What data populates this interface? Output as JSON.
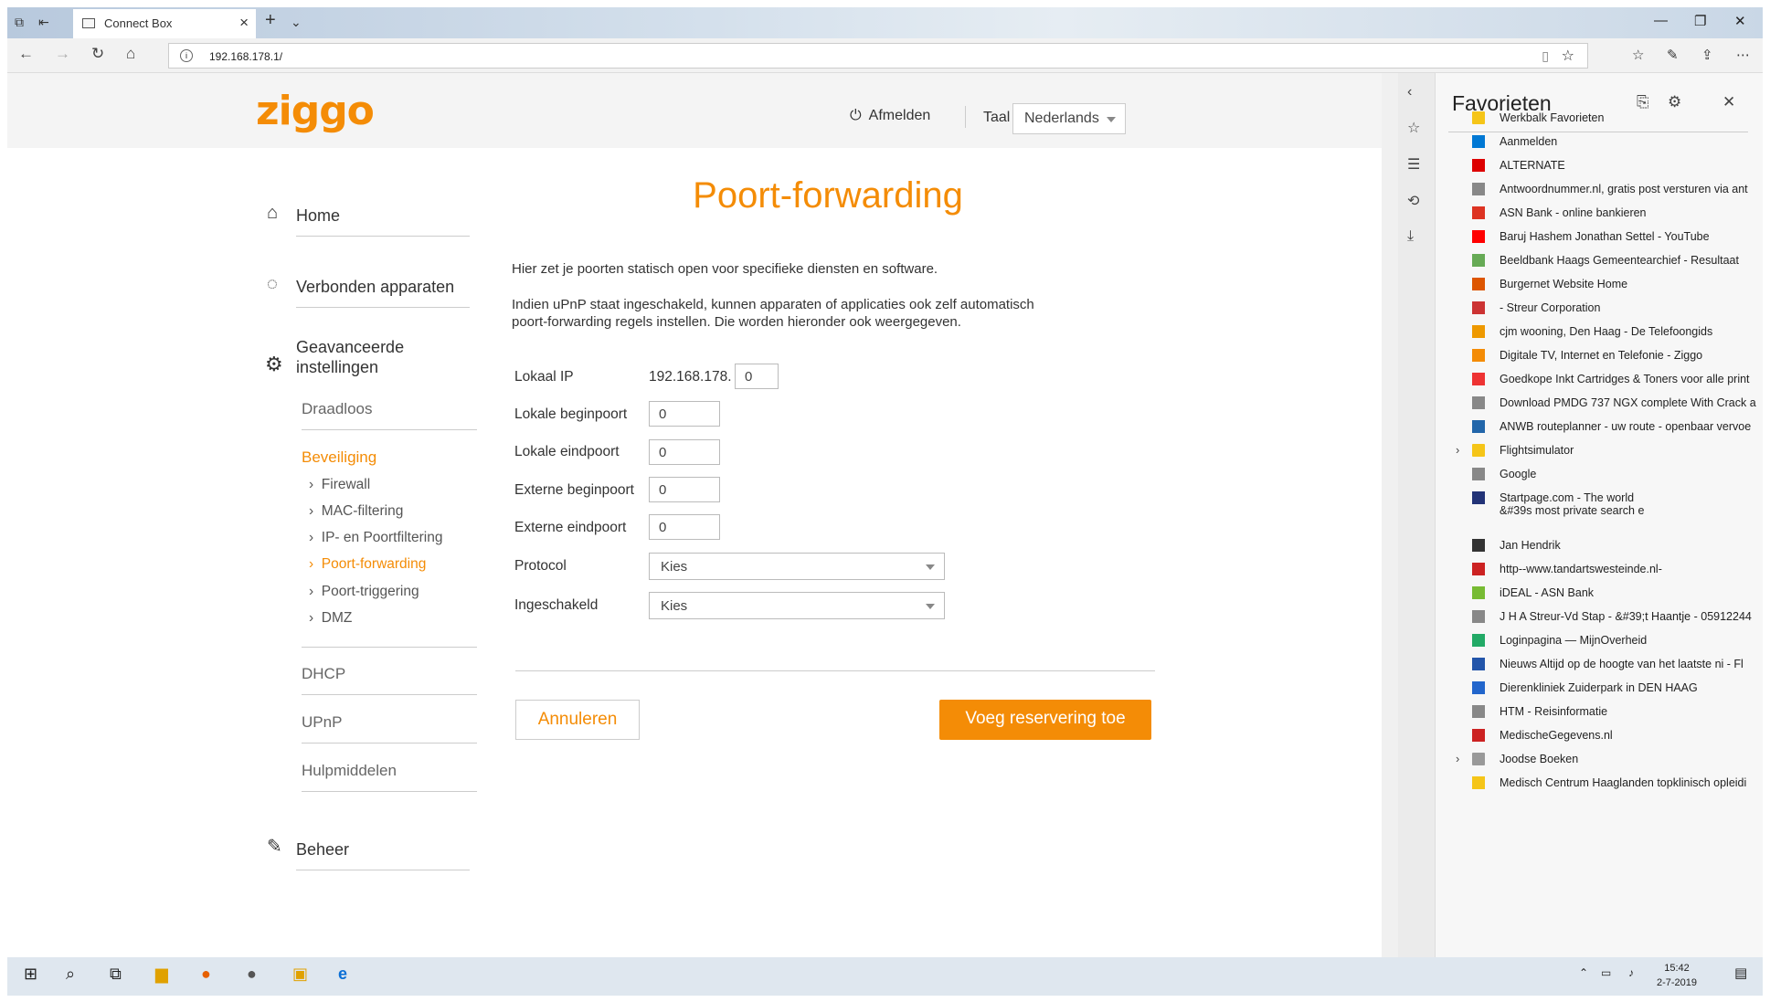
{
  "browser": {
    "tab_title": "Connect Box",
    "url": "192.168.178.1/"
  },
  "header": {
    "logo": "ziggo",
    "logout": "Afmelden",
    "language_label": "Taal",
    "language": "Nederlands"
  },
  "nav": {
    "home": "Home",
    "devices": "Verbonden apparaten",
    "advanced_1": "Geavanceerde",
    "advanced_2": "instellingen",
    "wireless": "Draadloos",
    "security": "Beveiliging",
    "security_items": [
      "Firewall",
      "MAC-filtering",
      "IP- en Poortfiltering",
      "Poort-forwarding",
      "Poort-triggering",
      "DMZ"
    ],
    "dhcp": "DHCP",
    "upnp": "UPnP",
    "tools": "Hulpmiddelen",
    "admin": "Beheer"
  },
  "main": {
    "title": "Poort-forwarding",
    "intro": "Hier zet je poorten statisch open voor specifieke diensten en software.",
    "upnp_1": "Indien uPnP staat ingeschakeld, kunnen apparaten of applicaties ook zelf automatisch",
    "upnp_2": "poort-forwarding regels instellen. Die worden hieronder ook weergegeven.",
    "form": {
      "local_ip_label": "Lokaal IP",
      "ip_prefix": "192.168.178.",
      "ip_value": "0",
      "local_start_label": "Lokale beginpoort",
      "local_start": "0",
      "local_end_label": "Lokale eindpoort",
      "local_end": "0",
      "ext_start_label": "Externe beginpoort",
      "ext_start": "0",
      "ext_end_label": "Externe eindpoort",
      "ext_end": "0",
      "protocol_label": "Protocol",
      "protocol": "Kies",
      "enabled_label": "Ingeschakeld",
      "enabled": "Kies"
    },
    "cancel": "Annuleren",
    "add": "Voeg reservering toe"
  },
  "favorites": {
    "title": "Favorieten",
    "items": [
      "Werkbalk Favorieten",
      "Aanmelden",
      "ALTERNATE",
      "Antwoordnummer.nl, gratis post versturen via ant",
      "ASN Bank - online bankieren",
      "Baruj Hashem Jonathan Settel - YouTube",
      "Beeldbank Haags Gemeentearchief - Resultaat",
      "Burgernet Website  Home",
      "- Streur Corporation",
      "cjm wooning, Den Haag - De Telefoongids",
      "Digitale TV, Internet en Telefonie - Ziggo",
      "Goedkope Inkt Cartridges & Toners voor alle print",
      "Download PMDG 737 NGX complete With Crack a",
      "ANWB routeplanner - uw route - openbaar vervoe",
      "Flightsimulator",
      "Google",
      "Startpage.com - The world",
      "&#39s most private search e",
      "Jan Hendrik",
      "http--www.tandartswesteinde.nl-",
      "iDEAL - ASN Bank",
      "J H A Streur-Vd Stap - &#39;t Haantje - 05912244",
      "Loginpagina — MijnOverheid",
      "Nieuws  Altijd op de hoogte van het laatste ni - Fl",
      "Dierenkliniek Zuiderpark in DEN HAAG",
      "HTM - Reisinformatie",
      "MedischeGegevens.nl",
      "Joodse Boeken",
      "Medisch Centrum Haaglanden topklinisch opleidi"
    ]
  },
  "taskbar": {
    "time": "15:42",
    "date": "2-7-2019"
  },
  "colors": {
    "accent": "#f48c06"
  }
}
